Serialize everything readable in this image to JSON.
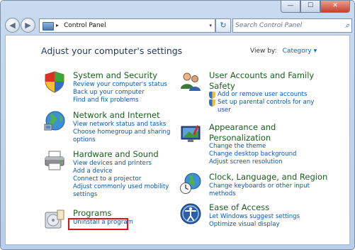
{
  "window": {
    "caption_buttons": {
      "minimize": "—",
      "maximize": "☐",
      "close": "✕"
    }
  },
  "toolbar": {
    "back_glyph": "◀",
    "forward_glyph": "▶",
    "address_separator": "▸",
    "address_path": "Control Panel",
    "address_dropdown": "▾",
    "refresh_glyph": "↻",
    "search_placeholder": "Search Control Panel",
    "search_glyph": "⌕"
  },
  "main": {
    "heading": "Adjust your computer's settings",
    "view_by_label": "View by:",
    "view_by_value": "Category ▾"
  },
  "categories_left": [
    {
      "title": "System and Security",
      "icon": "shield-icon",
      "links": [
        "Review your computer's status",
        "Back up your computer",
        "Find and fix problems"
      ]
    },
    {
      "title": "Network and Internet",
      "icon": "globe-network-icon",
      "links": [
        "View network status and tasks",
        "Choose homegroup and sharing",
        "options"
      ]
    },
    {
      "title": "Hardware and Sound",
      "icon": "printer-icon",
      "links": [
        "View devices and printers",
        "Add a device",
        "Connect to a projector",
        "Adjust commonly used mobility",
        "settings"
      ]
    },
    {
      "title": "Programs",
      "icon": "programs-icon",
      "links": [
        "Uninstall a program"
      ]
    }
  ],
  "categories_right": [
    {
      "title_line1": "User Accounts and Family",
      "title_line2": "Safety",
      "icon": "users-icon",
      "links": [
        "Add or remove user accounts",
        "Set up parental controls for any",
        "user"
      ]
    },
    {
      "title_line1": "Appearance and",
      "title_line2": "Personalization",
      "icon": "appearance-icon",
      "links": [
        "Change the theme",
        "Change desktop background",
        "Adjust screen resolution"
      ]
    },
    {
      "title": "Clock, Language, and Region",
      "icon": "clock-globe-icon",
      "links": [
        "Change keyboards or other input",
        "methods"
      ]
    },
    {
      "title": "Ease of Access",
      "icon": "ease-of-access-icon",
      "links": [
        "Let Windows suggest settings",
        "Optimize visual display"
      ]
    }
  ],
  "colors": {
    "category_title": "#1a5e1e",
    "link": "#0b57b5",
    "heading": "#1e395b",
    "highlight_box": "#e0121a"
  }
}
